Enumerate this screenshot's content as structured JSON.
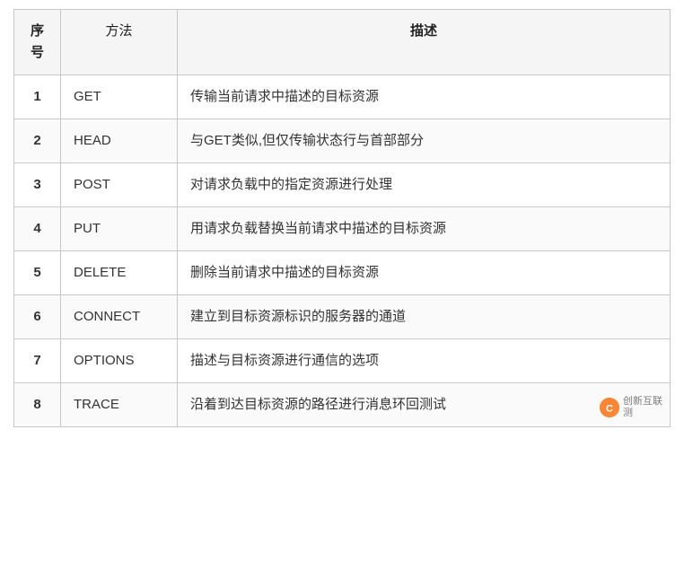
{
  "table": {
    "headers": {
      "num": "序\n号",
      "method": "方法",
      "desc": "描述"
    },
    "rows": [
      {
        "num": "1",
        "method": "GET",
        "desc": "传输当前请求中描述的目标资源"
      },
      {
        "num": "2",
        "method": "HEAD",
        "desc": "与GET类似,但仅传输状态行与首部部分"
      },
      {
        "num": "3",
        "method": "POST",
        "desc": "对请求负载中的指定资源进行处理"
      },
      {
        "num": "4",
        "method": "PUT",
        "desc": "用请求负载替换当前请求中描述的目标资源"
      },
      {
        "num": "5",
        "method": "DELETE",
        "desc": "删除当前请求中描述的目标资源"
      },
      {
        "num": "6",
        "method": "CONNECT",
        "desc": "建立到目标资源标识的服务器的通道"
      },
      {
        "num": "7",
        "method": "OPTIONS",
        "desc": "描述与目标资源进行通信的选项"
      },
      {
        "num": "8",
        "method": "TRACE",
        "desc": "沿着到达目标资源的路径进行消息环回测试"
      }
    ]
  },
  "watermark": {
    "logo_text": "C",
    "line1": "创新互联",
    "line2": "测"
  }
}
